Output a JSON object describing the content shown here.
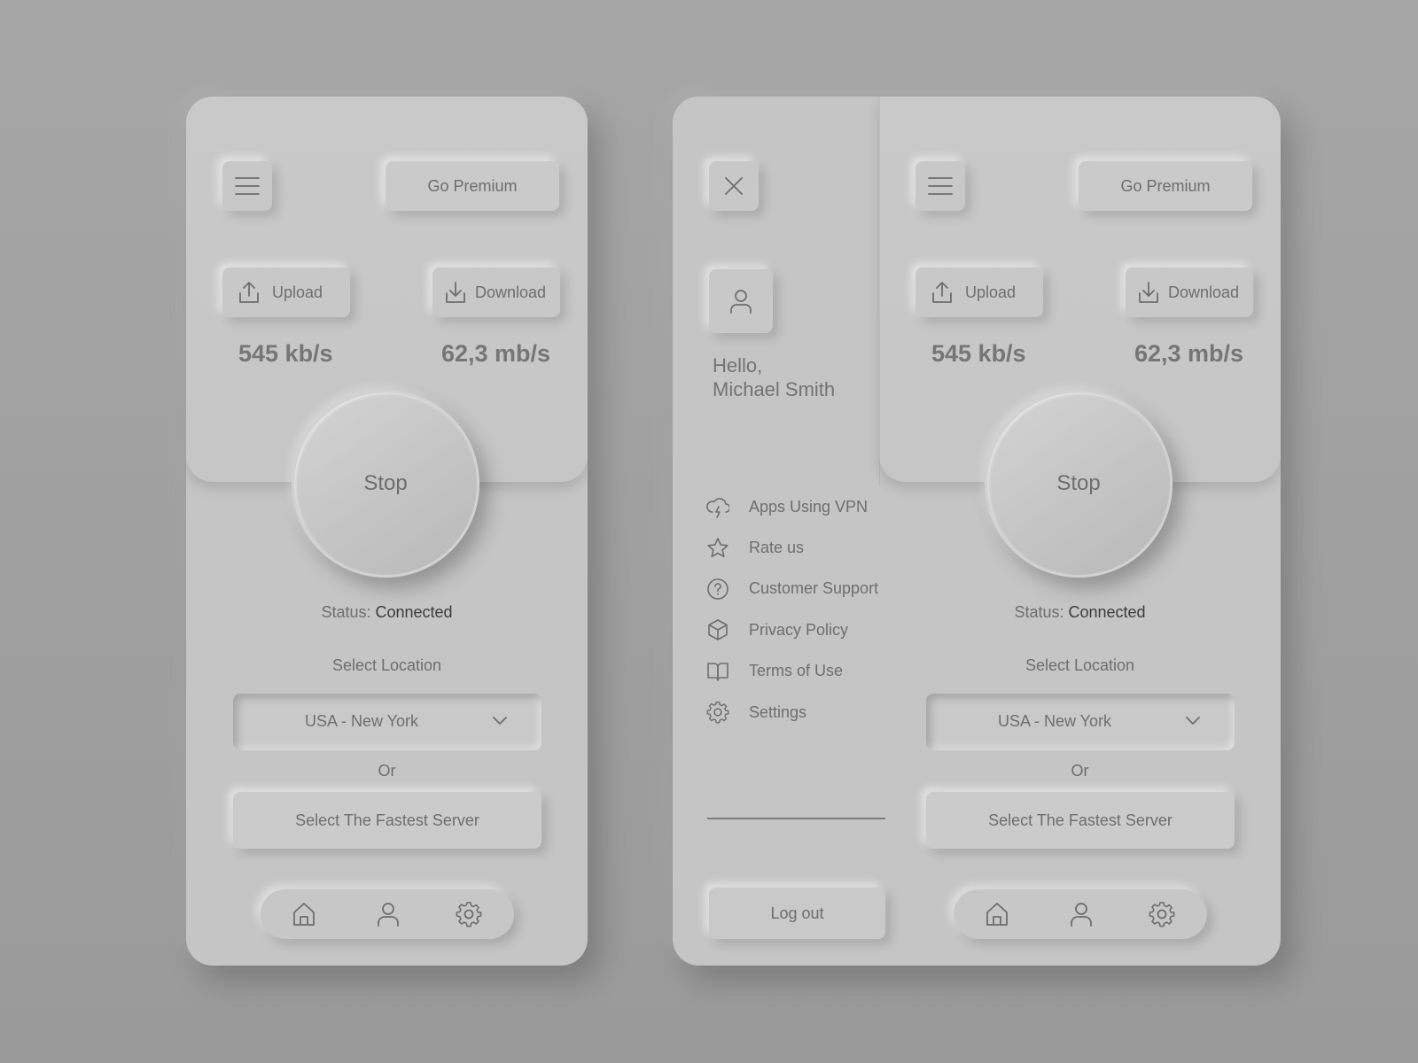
{
  "screens": [
    {
      "premium_label": "Go Premium",
      "upload_label": "Upload",
      "download_label": "Download",
      "upload_speed": "545 kb/s",
      "download_speed": "62,3 mb/s",
      "stop_label": "Stop",
      "status_label": "Status:",
      "status_value": "Connected",
      "select_location_label": "Select Location",
      "location_value": "USA - New York",
      "or_label": "Or",
      "fastest_server_label": "Select The Fastest Server",
      "nav_icons": [
        "home-icon",
        "user-icon",
        "settings-icon"
      ]
    },
    {
      "premium_label": "Go Premium",
      "upload_label": "Upload",
      "download_label": "Download",
      "upload_speed": "545 kb/s",
      "download_speed": "62,3 mb/s",
      "stop_label": "Stop",
      "status_label": "Status:",
      "status_value": "Connected",
      "select_location_label": "Select Location",
      "location_value": "USA - New York",
      "or_label": "Or",
      "fastest_server_label": "Select The Fastest Server",
      "nav_icons": [
        "home-icon",
        "user-icon",
        "settings-icon"
      ]
    }
  ],
  "drawer": {
    "greeting_line1": "Hello,",
    "greeting_line2": "Michael Smith",
    "menu_items": [
      {
        "label": "Apps Using VPN",
        "icon": "cloud-lightning-icon"
      },
      {
        "label": "Rate us",
        "icon": "star-icon"
      },
      {
        "label": "Customer Support",
        "icon": "help-circle-icon"
      },
      {
        "label": "Privacy Policy",
        "icon": "box-icon"
      },
      {
        "label": "Terms of Use",
        "icon": "book-icon"
      },
      {
        "label": "Settings",
        "icon": "settings-icon"
      }
    ],
    "logout_label": "Log out"
  },
  "colors": {
    "background": "#a0a0a0",
    "surface": "#c5c5c5",
    "text": "#6e6e6e",
    "status_value": "#3c3c3c"
  }
}
